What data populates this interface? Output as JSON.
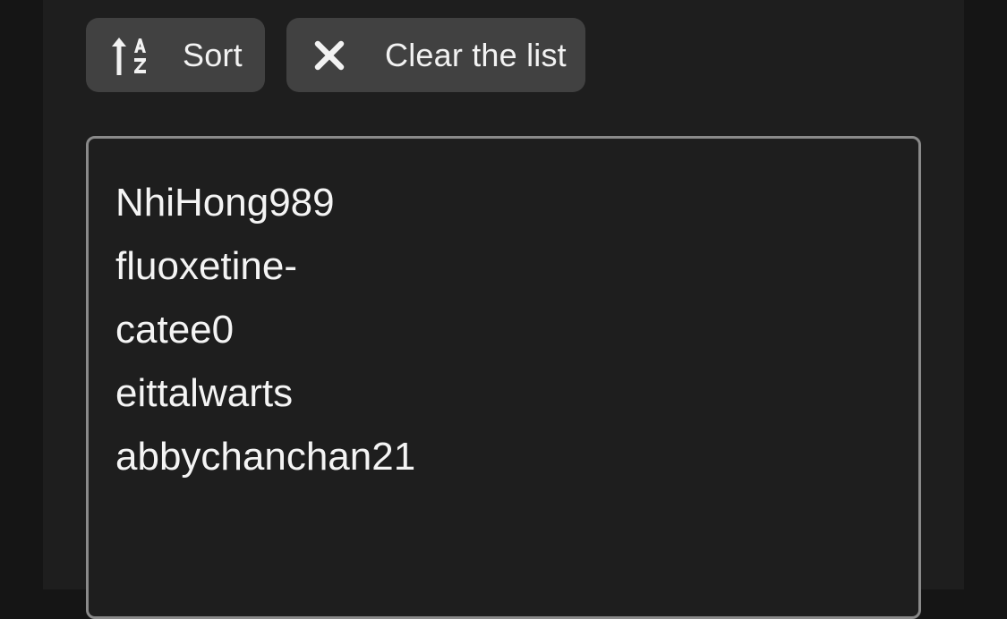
{
  "toolbar": {
    "sort_label": "Sort",
    "sort_icon": "sort-alpha-asc-icon",
    "clear_label": "Clear the list",
    "clear_icon": "close-icon"
  },
  "list": {
    "items": [
      "NhiHong989",
      "fluoxetine-",
      "catee0",
      "eittalwarts",
      "abbychanchan21"
    ]
  },
  "colors": {
    "page_bg": "#151515",
    "panel_bg": "#1e1e1e",
    "button_bg": "#414141",
    "text": "#f2f2f2",
    "textarea_border": "#8a8a8a"
  }
}
